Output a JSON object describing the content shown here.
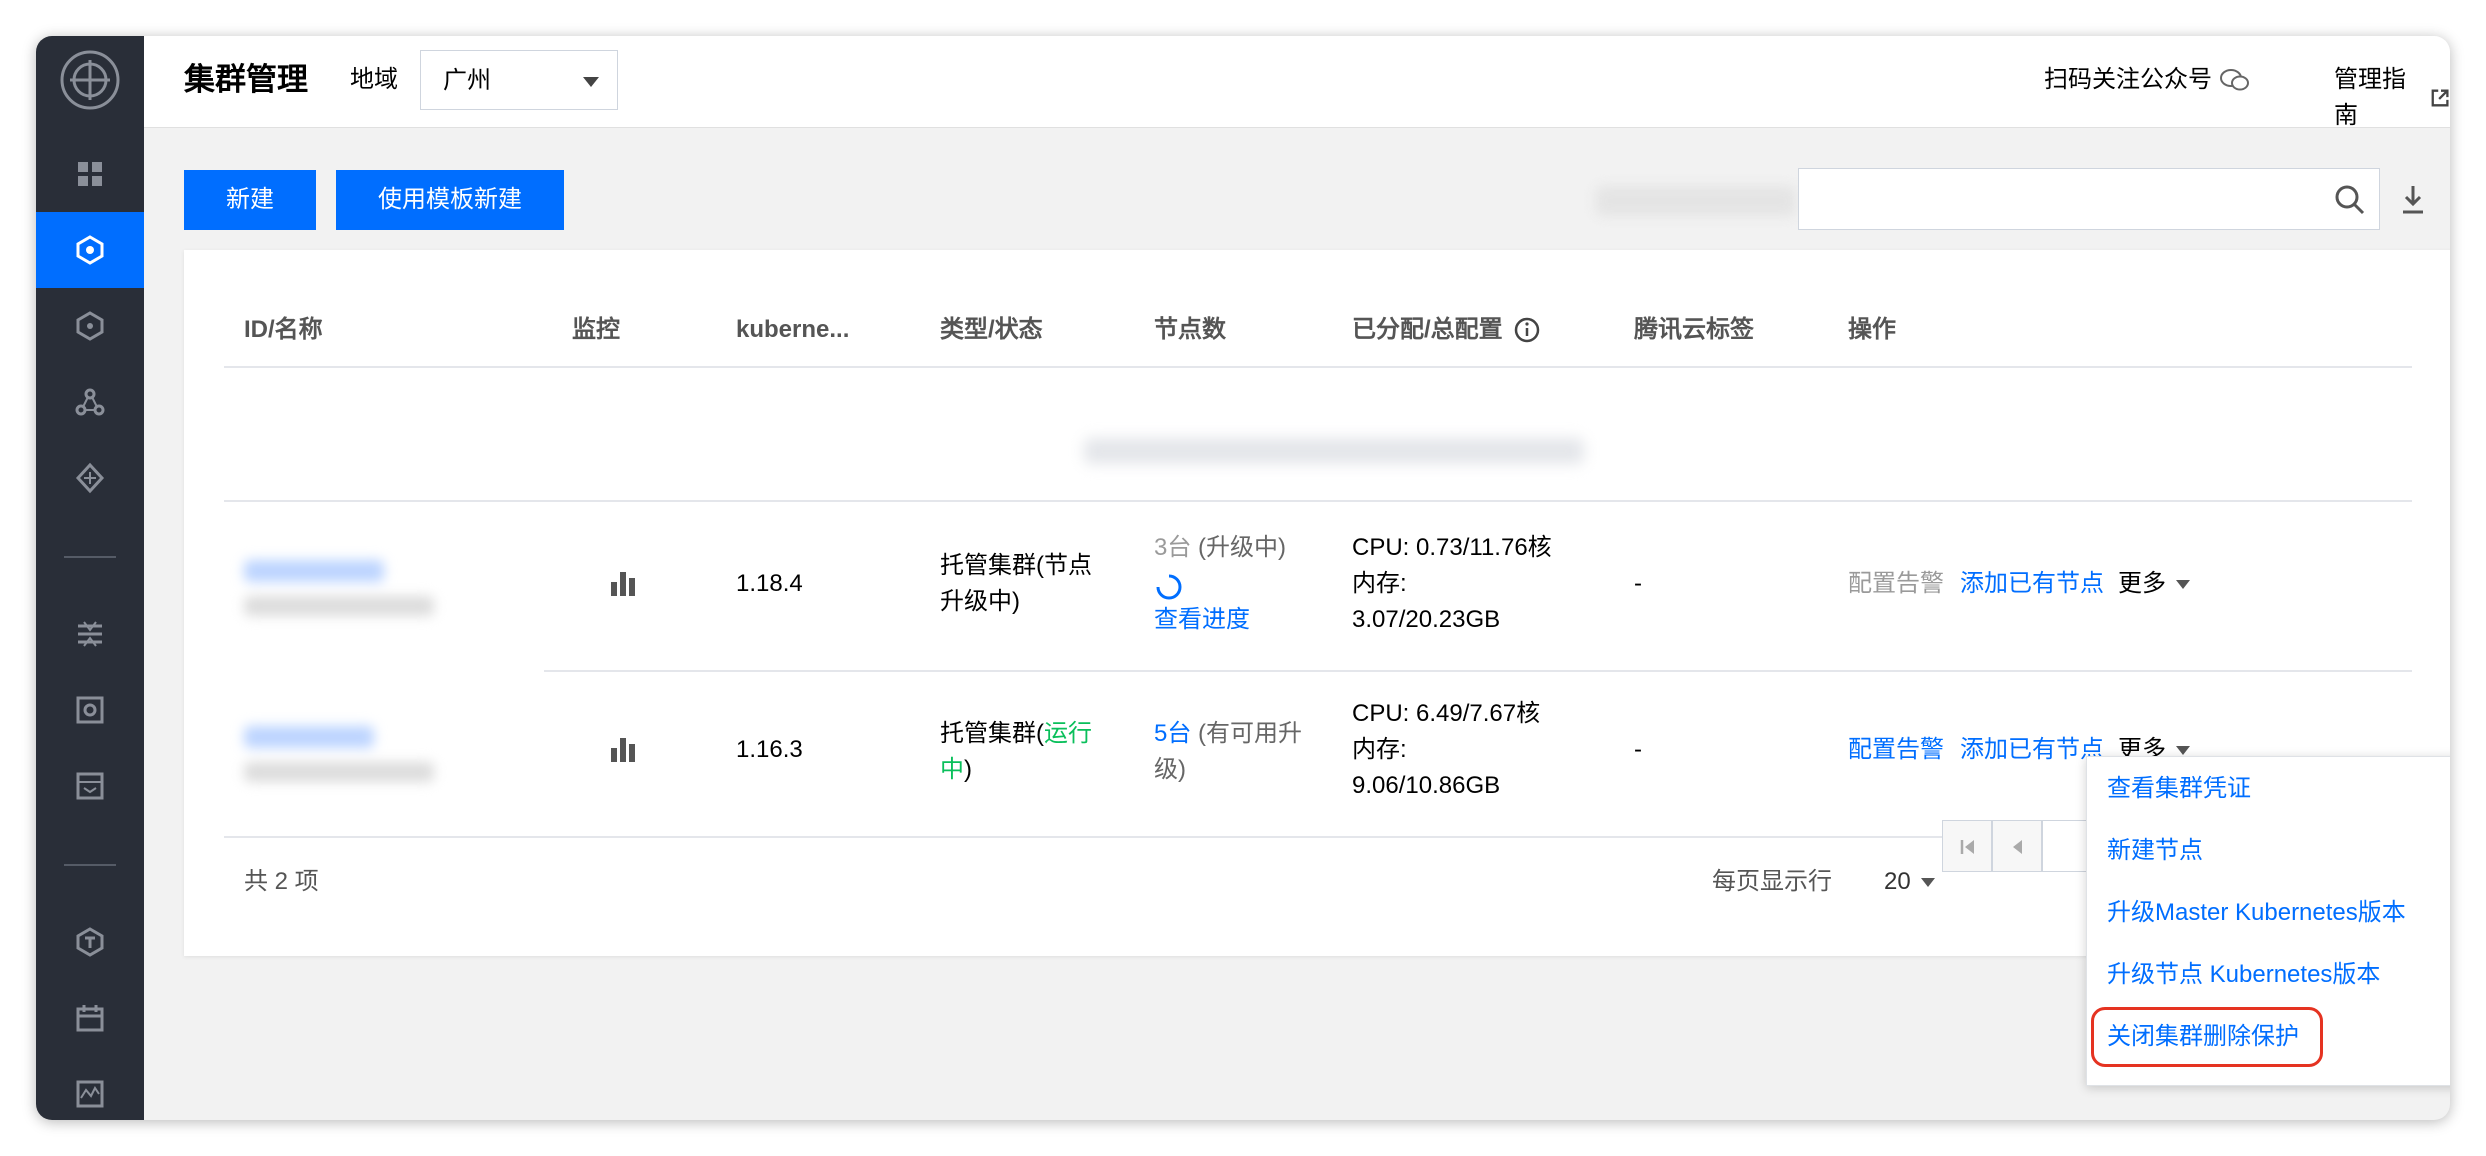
{
  "topbar": {
    "title": "集群管理",
    "region_label": "地域",
    "region_value": "广州",
    "qr_link": "扫码关注公众号",
    "guide_link": "管理指南"
  },
  "toolbar": {
    "new_button": "新建",
    "template_button": "使用模板新建"
  },
  "table": {
    "headers": [
      "ID/名称",
      "监控",
      "kuberne...",
      "类型/状态",
      "节点数",
      "已分配/总配置",
      "腾讯云标签",
      "操作"
    ],
    "rows": [
      {
        "version": "1.18.4",
        "type_line1": "托管集群(节点",
        "type_line2": "升级中)",
        "nodes_count": "3台",
        "nodes_status": "(升级中)",
        "nodes_link": "查看进度",
        "cpu": "CPU: 0.73/11.76核",
        "mem_label": "内存:",
        "mem_value": "3.07/20.23GB",
        "tags": "-",
        "action_alarm": "配置告警",
        "action_add": "添加已有节点",
        "action_more": "更多"
      },
      {
        "version": "1.16.3",
        "type_prefix": "托管集群(",
        "type_status_a": "运行",
        "type_status_b": "中",
        "type_suffix": ")",
        "nodes_count": "5台",
        "nodes_status_a": "(有可用升",
        "nodes_status_b": "级)",
        "cpu": "CPU: 6.49/7.67核",
        "mem_label": "内存:",
        "mem_value": "9.06/10.86GB",
        "tags": "-",
        "action_alarm": "配置告警",
        "action_add": "添加已有节点",
        "action_more": "更多"
      }
    ]
  },
  "footer": {
    "total": "共 2 项",
    "page_size_label": "每页显示行",
    "page_size_value": "20"
  },
  "dropdown": {
    "items": [
      "查看集群凭证",
      "新建节点",
      "升级Master Kubernetes版本",
      "升级节点 Kubernetes版本",
      "关闭集群删除保护"
    ]
  },
  "colors": {
    "accent": "#006eff",
    "sidebar": "#292e38",
    "highlight": "#e53321",
    "success": "#0abf5b"
  },
  "icons": [
    "product-logo-icon",
    "overview-icon",
    "cluster-icon",
    "application-icon",
    "helm-icon",
    "network-icon",
    "config-icon",
    "storage-icon",
    "registry-icon",
    "tke-icon",
    "event-icon",
    "monitor-icon",
    "wechat-icon",
    "external-link-icon",
    "search-icon",
    "download-icon",
    "bar-chart-icon",
    "loading-spinner-icon",
    "info-icon"
  ]
}
